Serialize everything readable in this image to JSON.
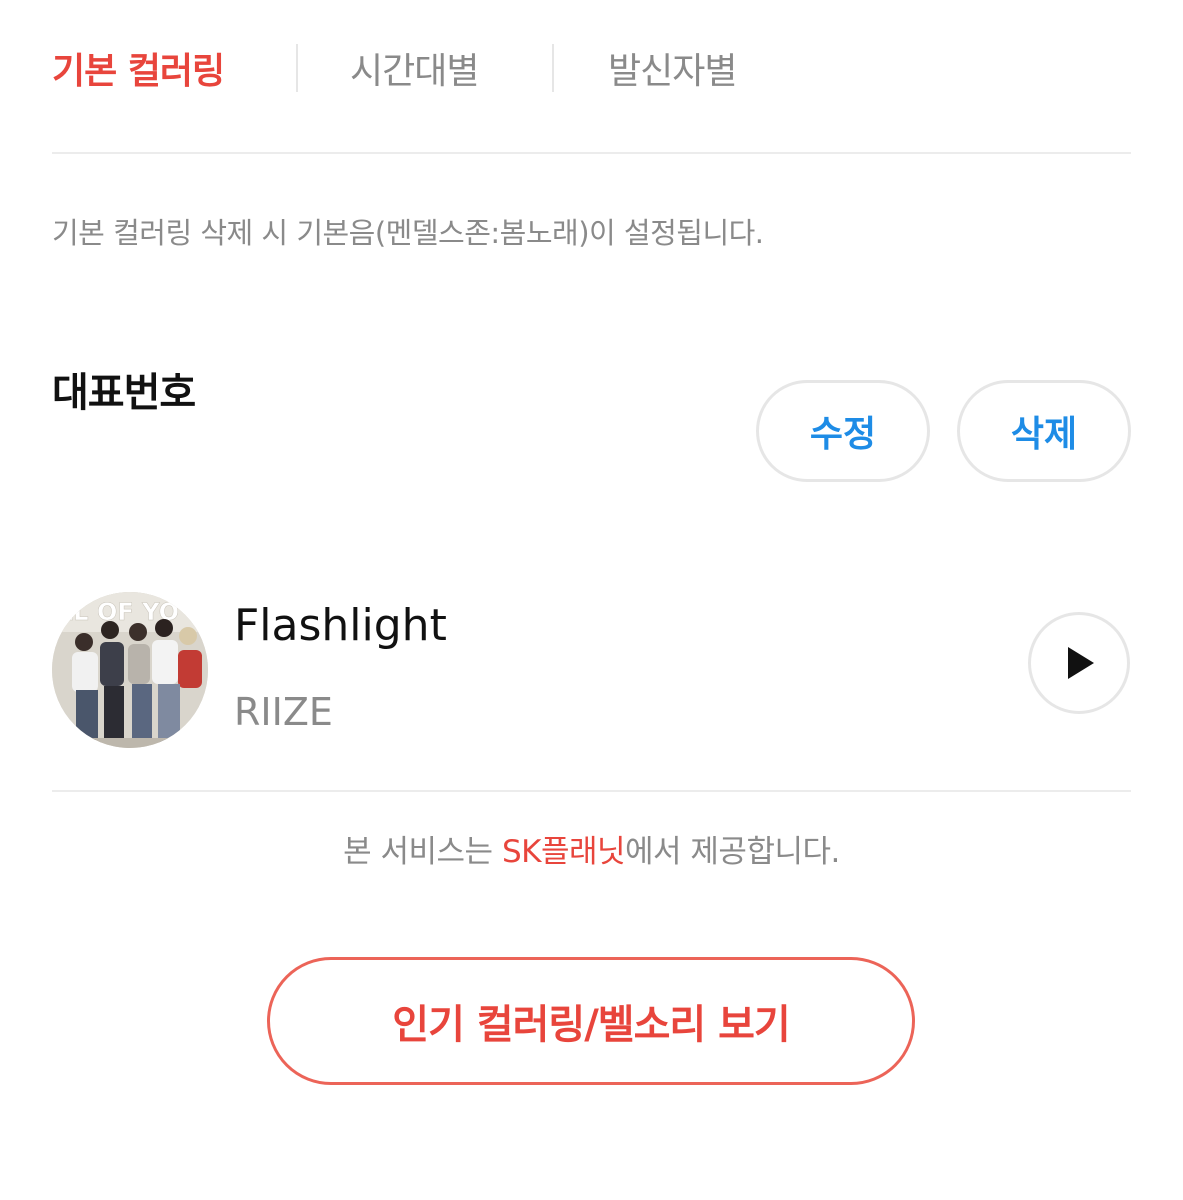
{
  "tabs": [
    {
      "label": "기본 컬러링",
      "active": true
    },
    {
      "label": "시간대별",
      "active": false
    },
    {
      "label": "발신자별",
      "active": false
    }
  ],
  "notice": "기본 컬러링 삭제 시 기본음(멘델스존:봄노래)이 설정됩니다.",
  "section": {
    "title": "대표번호",
    "edit_label": "수정",
    "delete_label": "삭제"
  },
  "song": {
    "title": "Flashlight",
    "artist": "RIIZE",
    "cover_text": "LL OF YO",
    "play_icon": "play-icon"
  },
  "provider": {
    "prefix": "본 서비스는 ",
    "brand": "SK플래닛",
    "suffix": "에서 제공합니다."
  },
  "popular_button": "인기 컬러링/벨소리 보기",
  "colors": {
    "accent": "#e8453c",
    "link_blue": "#1e8ce6",
    "muted_text": "#8a8a8a",
    "border": "#e6e6e6"
  }
}
